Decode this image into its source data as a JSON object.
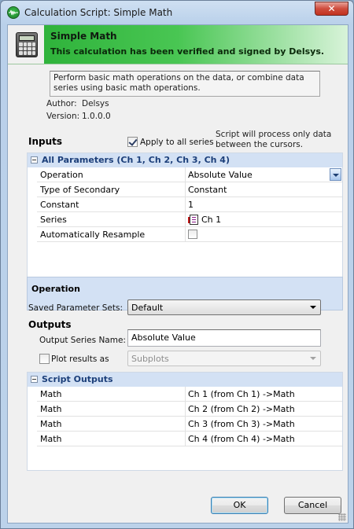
{
  "window": {
    "title": "Calculation Script: Simple Math",
    "close_glyph": "✕"
  },
  "header": {
    "title": "Simple Math",
    "subtitle": "This calculation has been verified and signed by Delsys.",
    "icon": "calculator-icon"
  },
  "description": "Perform basic math operations on the data, or combine data series using basic math operations.",
  "meta": {
    "author_label": "Author:",
    "author": "Delsys",
    "version_label": "Version:",
    "version": "1.0.0.0"
  },
  "inputs": {
    "heading": "Inputs",
    "apply_all_label": "Apply to all series",
    "apply_all_checked": true,
    "note": "Script will process only data between the cursors.",
    "group_title": "All Parameters (Ch 1, Ch 2, Ch 3, Ch 4)",
    "rows": [
      {
        "name": "Operation",
        "value": "Absolute Value"
      },
      {
        "name": "Type of Secondary",
        "value": "Constant"
      },
      {
        "name": "Constant",
        "value": "1"
      },
      {
        "name": "Series",
        "value": "Ch 1"
      },
      {
        "name": "Automatically Resample",
        "value": ""
      }
    ],
    "description_title": "Operation"
  },
  "saved_sets": {
    "label": "Saved Parameter Sets:",
    "value": "Default"
  },
  "outputs": {
    "heading": "Outputs",
    "series_name_label": "Output Series Name:",
    "series_name_value": "Absolute Value",
    "plot_label": "Plot results as",
    "plot_value": "Subplots",
    "group_title": "Script Outputs",
    "rows": [
      {
        "name": "Math",
        "value": "Ch 1 (from Ch 1) ->Math"
      },
      {
        "name": "Math",
        "value": "Ch 2 (from Ch 2) ->Math"
      },
      {
        "name": "Math",
        "value": "Ch 3 (from Ch 3) ->Math"
      },
      {
        "name": "Math",
        "value": "Ch 4 (from Ch 4) ->Math"
      }
    ]
  },
  "buttons": {
    "ok": "OK",
    "cancel": "Cancel"
  },
  "colors": {
    "header_green": "#2fb33b",
    "group_blue": "#d3e1f4",
    "group_title": "#1c3f7a"
  }
}
